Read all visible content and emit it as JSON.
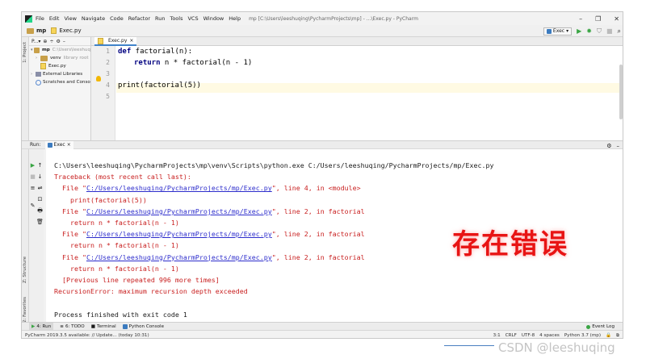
{
  "window": {
    "menu": [
      "File",
      "Edit",
      "View",
      "Navigate",
      "Code",
      "Refactor",
      "Run",
      "Tools",
      "VCS",
      "Window",
      "Help"
    ],
    "title": "mp [C:\\Users\\leeshuqing\\PycharmProjects\\mp] - ...\\Exec.py - PyCharm",
    "controls": {
      "minimize": "–",
      "maximize": "❐",
      "close": "✕"
    }
  },
  "navbar": {
    "root": "mp",
    "file": "Exec.py",
    "run_config": "Exec",
    "run_config_arrow": "▾",
    "icons": {
      "run": "▶",
      "debug": "✹",
      "coverage": "⛉",
      "stop": "■",
      "search": "⌕"
    }
  },
  "side_labels": {
    "project": "1: Project",
    "structure": "Z: Structure",
    "favorites": "2: Favorites"
  },
  "project_panel": {
    "title": "P...▾",
    "tools": [
      "⊕",
      "÷",
      "⚙",
      "–"
    ],
    "tree": [
      {
        "arrow": "▾",
        "name": "mp",
        "hint": "C:\\Users\\leeshuq",
        "kind": "folder"
      },
      {
        "arrow": "›",
        "name": "venv",
        "hint": "library root",
        "kind": "folder"
      },
      {
        "arrow": "",
        "name": "Exec.py",
        "hint": "",
        "kind": "file"
      },
      {
        "arrow": "›",
        "name": "External Libraries",
        "hint": "",
        "kind": "lib"
      },
      {
        "arrow": "",
        "name": "Scratches and Conso",
        "hint": "",
        "kind": "scratch"
      }
    ]
  },
  "editor": {
    "tab_label": "Exec.py",
    "tab_close": "×",
    "line_numbers": [
      "1",
      "2",
      "3",
      "4",
      "5"
    ],
    "code": {
      "l1_kw": "def",
      "l1_rest": " factorial(n):",
      "l2_kw": "return",
      "l2_rest": " n * factorial(n - 1)",
      "l4_rest": "print(factorial(5))"
    }
  },
  "run_panel": {
    "label": "Run:",
    "tab": "Exec",
    "tab_close": "×",
    "header_icons": {
      "settings": "⚙",
      "hide": "–"
    },
    "tool_icons": [
      "▶",
      "↑",
      "■",
      "↓",
      "≡",
      "⇌",
      "⊡",
      "🖶",
      "✎",
      "🗑"
    ],
    "lines": [
      {
        "text": "C:\\Users\\leeshuqing\\PycharmProjects\\mp\\venv\\Scripts\\python.exe C:/Users/leeshuqing/PycharmProjects/mp/Exec.py",
        "color": "black"
      },
      {
        "text": "Traceback (most recent call last):",
        "color": "red"
      },
      {
        "pre": "  File \"",
        "link": "C:/Users/leeshuqing/PycharmProjects/mp/Exec.py",
        "post": "\", line 4, in <module>"
      },
      {
        "text": "    print(factorial(5))",
        "color": "red"
      },
      {
        "pre": "  File \"",
        "link": "C:/Users/leeshuqing/PycharmProjects/mp/Exec.py",
        "post": "\", line 2, in factorial"
      },
      {
        "text": "    return n * factorial(n - 1)",
        "color": "red"
      },
      {
        "pre": "  File \"",
        "link": "C:/Users/leeshuqing/PycharmProjects/mp/Exec.py",
        "post": "\", line 2, in factorial"
      },
      {
        "text": "    return n * factorial(n - 1)",
        "color": "red"
      },
      {
        "pre": "  File \"",
        "link": "C:/Users/leeshuqing/PycharmProjects/mp/Exec.py",
        "post": "\", line 2, in factorial"
      },
      {
        "text": "    return n * factorial(n - 1)",
        "color": "red"
      },
      {
        "text": "  [Previous line repeated 996 more times]",
        "color": "red"
      },
      {
        "text": "RecursionError: maximum recursion depth exceeded",
        "color": "red"
      },
      {
        "text": "",
        "color": "black"
      },
      {
        "text": "Process finished with exit code 1",
        "color": "black"
      }
    ],
    "stamp": "存在错误"
  },
  "bottom_tabs": {
    "run": "4: Run",
    "todo": "6: TODO",
    "terminal": "Terminal",
    "python_console": "Python Console",
    "event_log": "Event Log"
  },
  "statusbar": {
    "message": "PyCharm 2019.3.5 available: // Update... (today 10:31)",
    "position": "3:1",
    "line_sep": "CRLF",
    "encoding": "UTF-8",
    "indent": "4 spaces",
    "interpreter": "Python 3.7 (mp)",
    "icons": [
      "🔒",
      "⧉"
    ]
  },
  "watermark": "CSDN @leeshuqing",
  "colors": {
    "error_red": "#c81e1e",
    "link_blue": "#2d2dcc",
    "keyword_navy": "#000080",
    "stamp_red": "#e81414"
  }
}
